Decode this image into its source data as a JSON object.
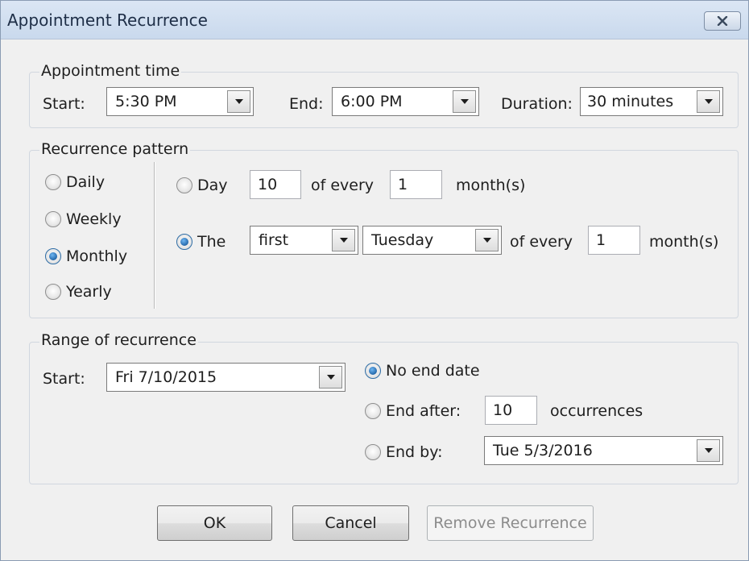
{
  "window": {
    "title": "Appointment Recurrence"
  },
  "appointment_time": {
    "group_title": "Appointment time",
    "start_label": "Start:",
    "start_value": "5:30 PM",
    "end_label": "End:",
    "end_value": "6:00 PM",
    "duration_label": "Duration:",
    "duration_value": "30 minutes"
  },
  "recurrence_pattern": {
    "group_title": "Recurrence pattern",
    "frequencies": [
      {
        "label": "Daily",
        "checked": false
      },
      {
        "label": "Weekly",
        "checked": false
      },
      {
        "label": "Monthly",
        "checked": true
      },
      {
        "label": "Yearly",
        "checked": false
      }
    ],
    "day_option": {
      "label": "Day",
      "checked": false,
      "day_value": "10",
      "of_every_label": "of every",
      "every_value": "1",
      "unit_label": "month(s)"
    },
    "the_option": {
      "label": "The",
      "checked": true,
      "ordinal_value": "first",
      "weekday_value": "Tuesday",
      "of_every_label": "of every",
      "every_value": "1",
      "unit_label": "month(s)"
    }
  },
  "range": {
    "group_title": "Range of recurrence",
    "start_label": "Start:",
    "start_value": "Fri 7/10/2015",
    "no_end_label": "No end date",
    "no_end_checked": true,
    "end_after_label": "End after:",
    "end_after_checked": false,
    "end_after_value": "10",
    "occurrences_label": "occurrences",
    "end_by_label": "End by:",
    "end_by_checked": false,
    "end_by_value": "Tue 5/3/2016"
  },
  "buttons": {
    "ok": "OK",
    "cancel": "Cancel",
    "remove": "Remove Recurrence"
  },
  "icons": {
    "close": "close-icon",
    "dropdown": "chevron-down-icon"
  },
  "colors": {
    "title_bar": "#dbe6f4",
    "dialog_bg": "#f0f0f0",
    "radio_selected": "#1b5da0"
  }
}
